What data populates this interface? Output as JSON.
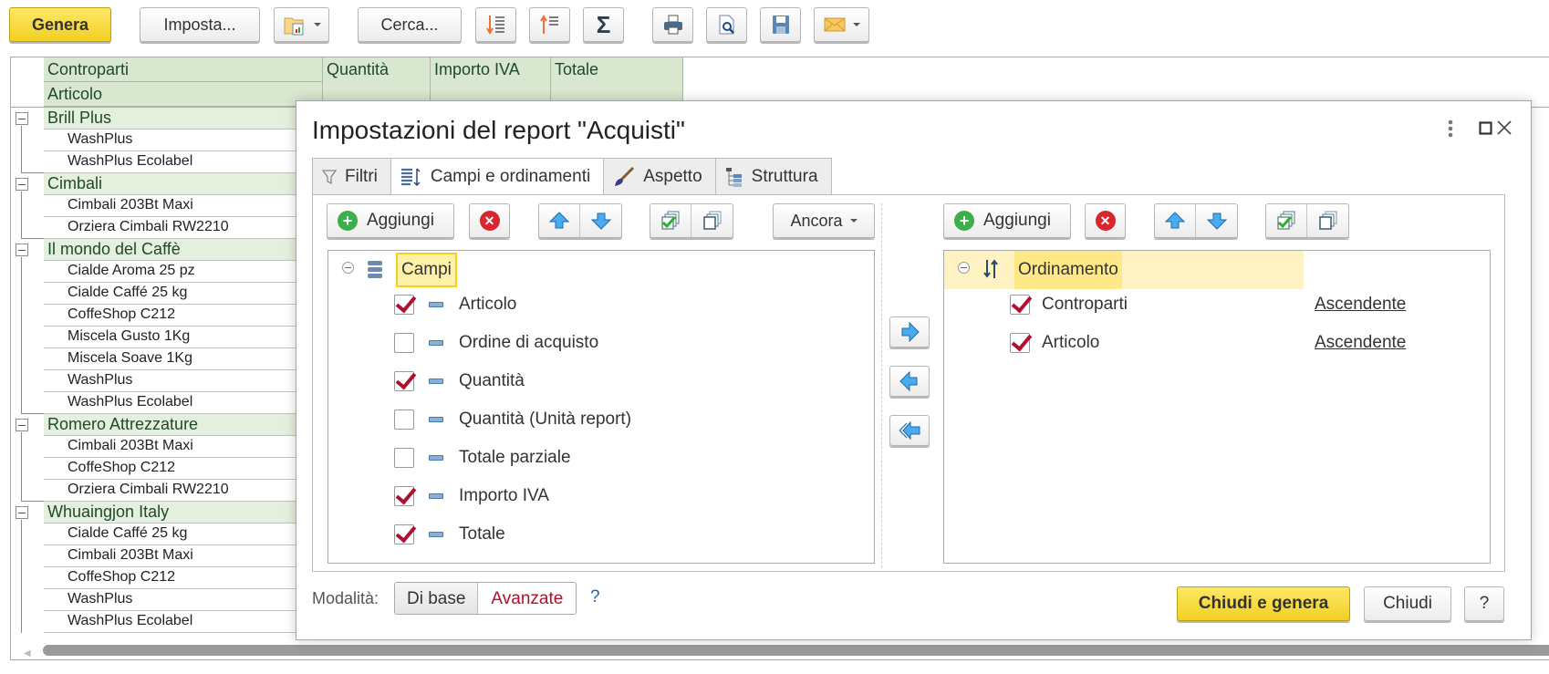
{
  "toolbar": {
    "generate_label": "Genera",
    "settings_label": "Imposta...",
    "find_label": "Cerca...",
    "icons": [
      "report-variant-icon",
      "sort-descending-icon",
      "sort-ascending-icon",
      "sum-icon",
      "print-icon",
      "print-preview-icon",
      "save-icon",
      "email-icon"
    ]
  },
  "report": {
    "headers": {
      "counterparties": "Controparti",
      "item": "Articolo",
      "quantity": "Quantità",
      "vat_amount": "Importo IVA",
      "total": "Totale"
    },
    "groups": [
      {
        "name": "Brill Plus",
        "items": [
          "WashPlus",
          "WashPlus Ecolabel"
        ]
      },
      {
        "name": "Cimbali",
        "items": [
          "Cimbali 203Bt Maxi",
          "Orziera Cimbali RW2210"
        ]
      },
      {
        "name": "Il mondo del Caffè",
        "items": [
          "Cialde Aroma 25 pz",
          "Cialde Caffé 25 kg",
          "CoffeShop C212",
          "Miscela Gusto 1Kg",
          "Miscela Soave 1Kg",
          "WashPlus",
          "WashPlus Ecolabel"
        ]
      },
      {
        "name": "Romero Attrezzature",
        "items": [
          "Cimbali 203Bt Maxi",
          "CoffeShop C212",
          "Orziera Cimbali RW2210"
        ]
      },
      {
        "name": "Whuaingjon Italy",
        "items": [
          "Cialde Caffé 25 kg",
          "Cimbali 203Bt Maxi",
          "CoffeShop C212",
          "WashPlus",
          "WashPlus Ecolabel"
        ]
      }
    ]
  },
  "dialog": {
    "title": "Impostazioni del report \"Acquisti\"",
    "tabs": [
      {
        "label": "Filtri",
        "icon": "filter-icon",
        "active": false
      },
      {
        "label": "Campi e ordinamenti",
        "icon": "fields-sort-icon",
        "active": true
      },
      {
        "label": "Aspetto",
        "icon": "brush-icon",
        "active": false
      },
      {
        "label": "Struttura",
        "icon": "structure-icon",
        "active": false
      }
    ],
    "fields": {
      "add_label": "Aggiungi",
      "more_label": "Ancora",
      "root_label": "Campi",
      "items": [
        {
          "label": "Articolo",
          "checked": true
        },
        {
          "label": "Ordine di acquisto",
          "checked": false
        },
        {
          "label": "Quantità",
          "checked": true
        },
        {
          "label": "Quantità (Unità report)",
          "checked": false
        },
        {
          "label": "Totale parziale",
          "checked": false
        },
        {
          "label": "Importo IVA",
          "checked": true
        },
        {
          "label": "Totale",
          "checked": true
        }
      ]
    },
    "sorting": {
      "add_label": "Aggiungi",
      "root_label": "Ordinamento",
      "items": [
        {
          "label": "Controparti",
          "checked": true,
          "direction": "Ascendente"
        },
        {
          "label": "Articolo",
          "checked": true,
          "direction": "Ascendente"
        }
      ]
    },
    "footer": {
      "mode_label": "Modalità:",
      "mode_basic": "Di base",
      "mode_advanced": "Avanzate",
      "mode_help": "?",
      "close_generate_label": "Chiudi e genera",
      "close_label": "Chiudi",
      "help_label": "?"
    }
  },
  "colors": {
    "accent_yellow": "#f5d42a",
    "header_green": "#d9e7d0",
    "group_green": "#e5efdd",
    "check_red": "#b01030",
    "highlight": "#fff3c4"
  }
}
